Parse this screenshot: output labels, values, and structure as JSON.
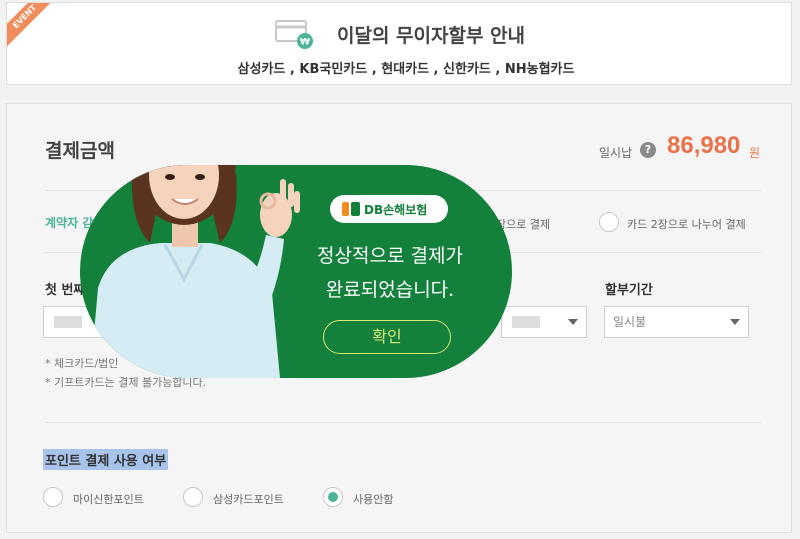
{
  "event_banner": {
    "ribbon": "EVENT",
    "title": "이달의 무이자할부 안내",
    "cards": "삼성카드 , KB국민카드 , 현대카드 , 신한카드 , NH농협카드"
  },
  "payment": {
    "title": "결제금액",
    "lump_sum_label": "일시납",
    "amount": "86,980",
    "currency": "원",
    "contractor_label": "계약자 감",
    "card_options": [
      "1장으로 결제",
      "카드 2장으로 나누어 결제"
    ],
    "first_card_label": "첫 번째",
    "installment_label": "할부기간",
    "installment_value": "일시불",
    "notes": [
      "* 체크카드/법인",
      "* 기프트카드는 결제 불가능합니다."
    ]
  },
  "points": {
    "title": "포인트 결제 사용 여부",
    "options": [
      "마이신한포인트",
      "삼성카드포인트",
      "사용안함"
    ],
    "selected_index": 2
  },
  "popup": {
    "brand": "DB손해보험",
    "message_line1": "정상적으로 결제가",
    "message_line2": "완료되었습니다.",
    "confirm_label": "확인"
  },
  "colors": {
    "accent_green": "#4bb49b",
    "amount_orange": "#e8734a",
    "popup_green": "#13803b",
    "confirm_yellow": "#d7ea76",
    "event_orange": "#f08d5c"
  }
}
